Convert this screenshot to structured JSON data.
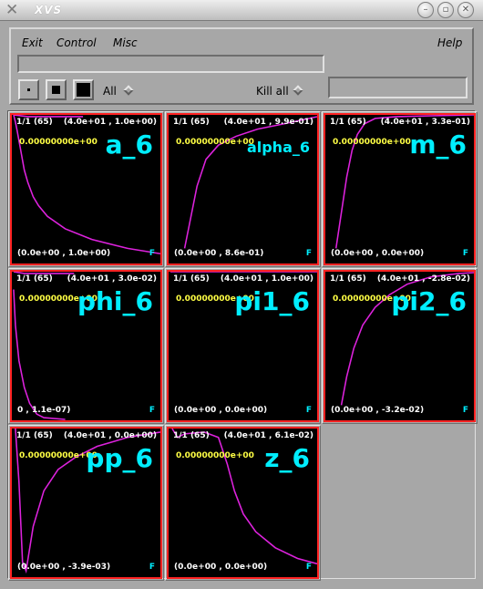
{
  "window": {
    "title": "XVS"
  },
  "menu": {
    "exit": "Exit",
    "control": "Control",
    "misc": "Misc",
    "help": "Help"
  },
  "toolbar": {
    "all_label": "All",
    "kill_label": "Kill all"
  },
  "panels": [
    {
      "header_left": "1/1 (65)",
      "header_right": "(4.0e+01 , 1.0e+00)",
      "time": "0.00000000e+00",
      "name": "a_6",
      "footer": "(0.0e+00 , 1.0e+00)",
      "flag": "F"
    },
    {
      "header_left": "1/1 (65)",
      "header_right": "(4.0e+01 , 9.9e-01)",
      "time": "0.00000000e+00",
      "name": "alpha_6",
      "footer": "(0.0e+00 , 8.6e-01)",
      "flag": "F"
    },
    {
      "header_left": "1/1 (65)",
      "header_right": "(4.0e+01 , 3.3e-01)",
      "time": "0.00000000e+00",
      "name": "m_6",
      "footer": "(0.0e+00 , 0.0e+00)",
      "flag": "F"
    },
    {
      "header_left": "1/1 (65)",
      "header_right": "(4.0e+01 , 3.0e-02)",
      "time": "0.00000000e+00",
      "name": "phi_6",
      "footer": "0 , 1.1e-07)",
      "flag": "F"
    },
    {
      "header_left": "1/1 (65)",
      "header_right": "(4.0e+01 , 1.0e+00)",
      "time": "0.00000000e+00",
      "name": "pi1_6",
      "footer": "(0.0e+00 , 0.0e+00)",
      "flag": "F"
    },
    {
      "header_left": "1/1 (65)",
      "header_right": "(4.0e+01 , -2.8e-02)",
      "time": "0.00000000e+00",
      "name": "pi2_6",
      "footer": "(0.0e+00 , -3.2e-02)",
      "flag": "F"
    },
    {
      "header_left": "1/1 (65)",
      "header_right": "(4.0e+01 , 0.0e+00)",
      "time": "0.00000000e+00",
      "name": "pp_6",
      "footer": "(0.0e+00 , -3.9e-03)",
      "flag": "F"
    },
    {
      "header_left": "1/1 (65)",
      "header_right": "(4.0e+01 , 6.1e-02)",
      "time": "0.00000000e+00",
      "name": "z_6",
      "footer": "(0.0e+00 , 0.0e+00)",
      "flag": "F"
    }
  ],
  "colors": {
    "plot_bg": "#000000",
    "frame": "#ff2222",
    "curve": "#dd22dd",
    "name": "#00eeff",
    "time": "#ffff44",
    "chrome": "#a7a7a7"
  },
  "icons": {
    "close": "x-logo-icon",
    "minimize": "minimize-icon",
    "maximize": "maximize-icon",
    "window_close": "close-icon"
  }
}
